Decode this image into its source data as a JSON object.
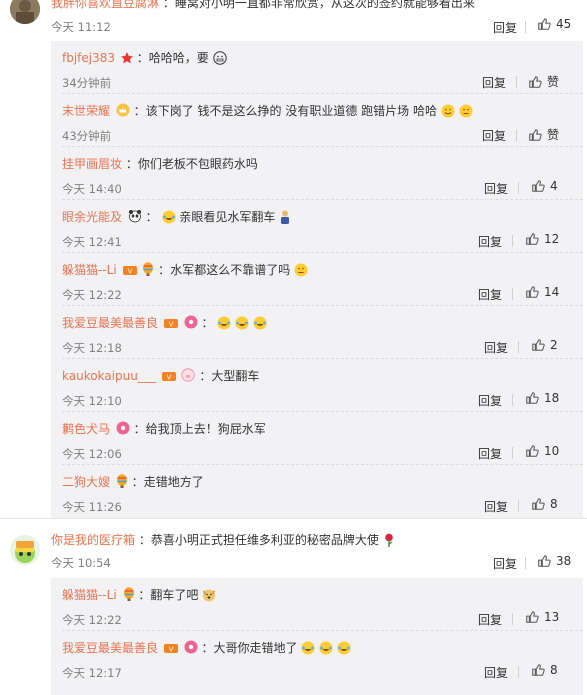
{
  "colors": {
    "username": "#eb7350",
    "muted": "#808080",
    "panel": "#f2f2f5"
  },
  "top_comment": {
    "username": "我胖你喜欢直豆腐淋",
    "text": "：睡窝对小明一直都非常欣赏，从这次的签约就能够看出来",
    "time": "今天 11:12",
    "reply_label": "回复",
    "likes": "45"
  },
  "thread1_replies": [
    {
      "user": "fbjfej383",
      "text": "哈哈哈，要",
      "time": "34分钟前",
      "reply": "回复",
      "like": "赞"
    },
    {
      "user": "末世荣耀",
      "text": "该下岗了 钱不是这么挣的 没有职业道德 跑错片场 哈哈",
      "time": "43分钟前",
      "reply": "回复",
      "like": "赞"
    },
    {
      "user": "挂甲画眉妆",
      "text": "你们老板不包眼药水吗",
      "time": "今天 14:40",
      "reply": "回复",
      "like": "4"
    },
    {
      "user": "眼余光能及",
      "text": "亲眼看见水军翻车",
      "time": "今天 12:41",
      "reply": "回复",
      "like": "12"
    },
    {
      "user": "躲猫猫--Li",
      "text": "水军都这么不靠谱了吗",
      "time": "今天 12:22",
      "reply": "回复",
      "like": "14"
    },
    {
      "user": "我爱豆最美最善良",
      "text": "",
      "time": "今天 12:18",
      "reply": "回复",
      "like": "2"
    },
    {
      "user": "kaukokaipuu___",
      "text": "大型翻车",
      "time": "今天 12:10",
      "reply": "回复",
      "like": "18"
    },
    {
      "user": "鹣色犬马",
      "text": "给我顶上去！狗屁水军",
      "time": "今天 12:06",
      "reply": "回复",
      "like": "10"
    },
    {
      "user": "二狗大嫂",
      "text": "走错地方了",
      "time": "今天 11:26",
      "reply": "回复",
      "like": "8"
    }
  ],
  "second_comment": {
    "username": "你是我的医疗箱",
    "text": "：恭喜小明正式担任维多利亚的秘密品牌大使",
    "time": "今天 10:54",
    "reply_label": "回复",
    "likes": "38"
  },
  "thread2_replies": [
    {
      "user": "躲猫猫--Li",
      "text": "翻车了吧",
      "time": "今天 12:22",
      "reply": "回复",
      "like": "13"
    },
    {
      "user": "我爱豆最美最善良",
      "text": "大哥你走错地了",
      "time": "今天 12:17",
      "reply": "回复",
      "like": "8"
    }
  ],
  "icons": [
    "thumb-up-icon",
    "emoji-icon",
    "badge-icon",
    "rose-icon"
  ]
}
